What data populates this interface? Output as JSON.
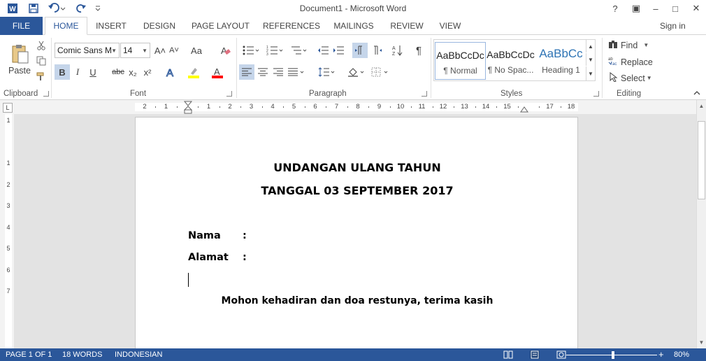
{
  "window": {
    "title": "Document1 - Microsoft Word",
    "controls": {
      "help": "?",
      "ribbon_display": "▣",
      "minimize": "–",
      "maximize": "□",
      "close": "✕"
    }
  },
  "qat": {
    "word_icon": "W",
    "save_icon": "save-icon",
    "undo_icon": "undo-icon",
    "redo_icon": "redo-icon"
  },
  "tabs": [
    {
      "label": "FILE"
    },
    {
      "label": "HOME"
    },
    {
      "label": "INSERT"
    },
    {
      "label": "DESIGN"
    },
    {
      "label": "PAGE LAYOUT"
    },
    {
      "label": "REFERENCES"
    },
    {
      "label": "MAILINGS"
    },
    {
      "label": "REVIEW"
    },
    {
      "label": "VIEW"
    }
  ],
  "active_tab": "HOME",
  "sign_in": "Sign in",
  "ribbon": {
    "clipboard": {
      "label": "Clipboard",
      "paste": "Paste"
    },
    "font": {
      "label": "Font",
      "font_name": "Comic Sans M",
      "font_size": "14",
      "bold": "B",
      "italic": "I",
      "underline": "U",
      "strike": "abc",
      "subscript": "x₂",
      "superscript": "x²",
      "grow": "A˄",
      "shrink": "A˅",
      "case": "Aa",
      "clear": "A"
    },
    "paragraph": {
      "label": "Paragraph",
      "show_marks": "¶"
    },
    "styles": {
      "label": "Styles",
      "items": [
        {
          "preview": "AaBbCcDc",
          "name": "¶ Normal"
        },
        {
          "preview": "AaBbCcDc",
          "name": "¶ No Spac..."
        },
        {
          "preview": "AaBbCc",
          "name": "Heading 1"
        }
      ]
    },
    "editing": {
      "label": "Editing",
      "find": "Find",
      "replace": "Replace",
      "select": "Select"
    }
  },
  "ruler": {
    "numbers": [
      "2",
      "1",
      "",
      "1",
      "2",
      "3",
      "4",
      "5",
      "6",
      "7",
      "8",
      "9",
      "10",
      "11",
      "12",
      "13",
      "14",
      "15",
      "",
      "17",
      "18"
    ]
  },
  "vruler": {
    "numbers": [
      "1",
      "",
      "1",
      "2",
      "3",
      "4",
      "5",
      "6",
      "7"
    ]
  },
  "document": {
    "heading1": "UNDANGAN ULANG TAHUN",
    "heading2": "TANGGAL 03 SEPTEMBER 2017",
    "fields": [
      {
        "label": "Nama",
        "colon": ":"
      },
      {
        "label": "Alamat",
        "colon": ":"
      }
    ],
    "closing": "Mohon kehadiran dan doa restunya, terima kasih"
  },
  "status": {
    "page": "PAGE 1 OF 1",
    "words": "18 WORDS",
    "language": "INDONESIAN",
    "zoom": "80%",
    "zoom_minus": "–",
    "zoom_plus": "+"
  },
  "colors": {
    "brand": "#2b579a",
    "highlight": "#ffff00",
    "font_color": "#ff0000",
    "active_button": "#c5d5ea"
  }
}
